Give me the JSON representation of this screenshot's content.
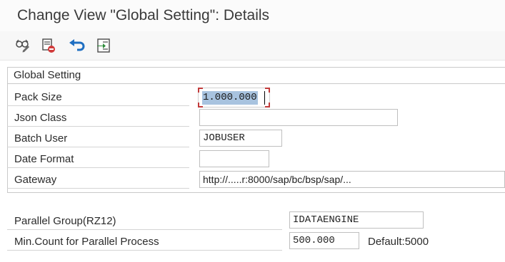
{
  "window": {
    "title": "Change View \"Global Setting\": Details"
  },
  "toolbar": {
    "buttons": [
      {
        "icon": "display-change-icon"
      },
      {
        "icon": "delete-icon"
      },
      {
        "icon": "undo-icon"
      },
      {
        "icon": "select-block-icon"
      }
    ]
  },
  "global_setting": {
    "title": "Global Setting",
    "pack_size": {
      "label": "Pack Size",
      "value": "1.000.000"
    },
    "json_class": {
      "label": "Json Class",
      "value": ""
    },
    "batch_user": {
      "label": "Batch User",
      "value": "JOBUSER"
    },
    "date_format": {
      "label": "Date Format",
      "value": ""
    },
    "gateway": {
      "label": "Gateway",
      "value": "http://.....r:8000/sap/bc/bsp/sap/..."
    }
  },
  "parallel": {
    "group": {
      "label": "Parallel Group(RZ12)",
      "value": "IDATAENGINE"
    },
    "min_count": {
      "label": "Min.Count for Parallel Process",
      "value": "500.000",
      "hint": "Default:5000"
    }
  },
  "colors": {
    "focus_corner": "#c23b3b",
    "selection": "#a8c3df",
    "undo_blue": "#1f6fc2"
  }
}
